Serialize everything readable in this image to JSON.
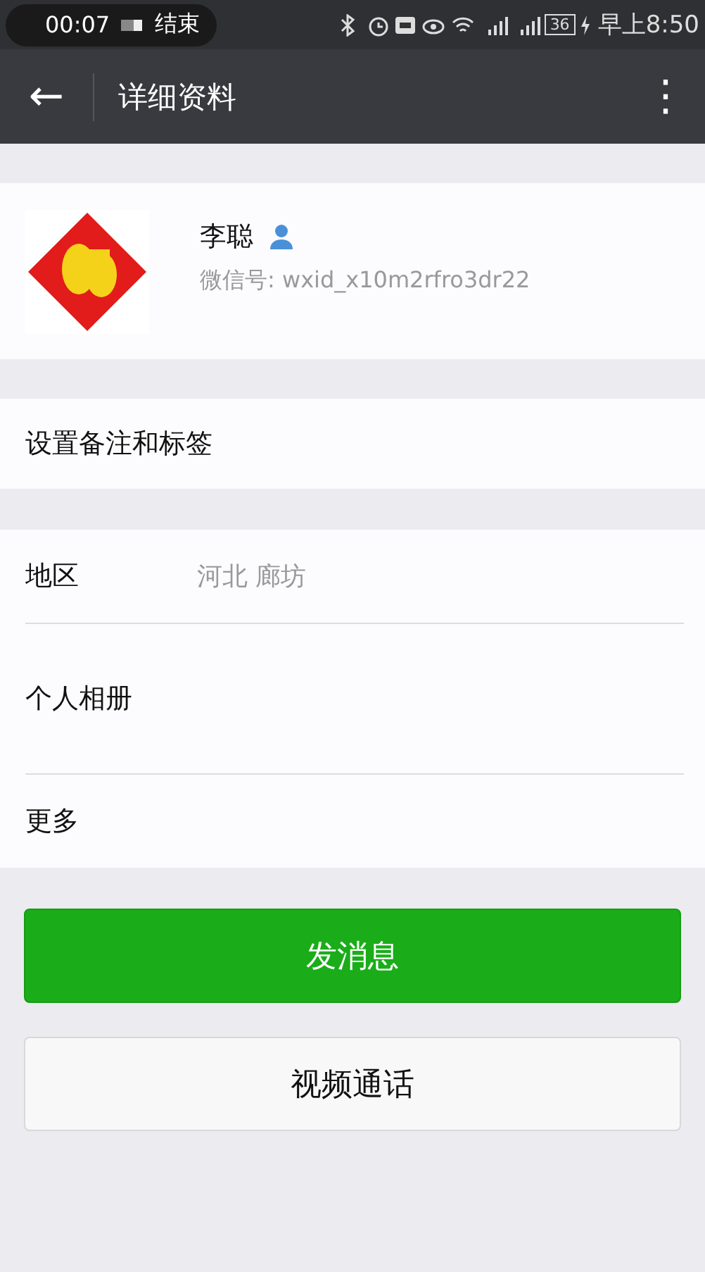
{
  "status_bar": {
    "call_timer": "00:07",
    "call_action": "结束",
    "battery": "36",
    "time": "早上8:50"
  },
  "top_bar": {
    "back": "←",
    "title": "详细资料",
    "more": "⋮"
  },
  "profile": {
    "name": "李聪",
    "wechat_id": "微信号: wxid_x10m2rfro3dr22"
  },
  "remark_row": {
    "label": "设置备注和标签"
  },
  "info_rows": [
    {
      "label": "地区",
      "value": "河北  廊坊"
    },
    {
      "label": "个人相册"
    },
    {
      "label": "更多"
    }
  ],
  "buttons": [
    {
      "label": "发消息",
      "kind": "primary"
    },
    {
      "label": "视频通话",
      "kind": "secondary"
    }
  ]
}
